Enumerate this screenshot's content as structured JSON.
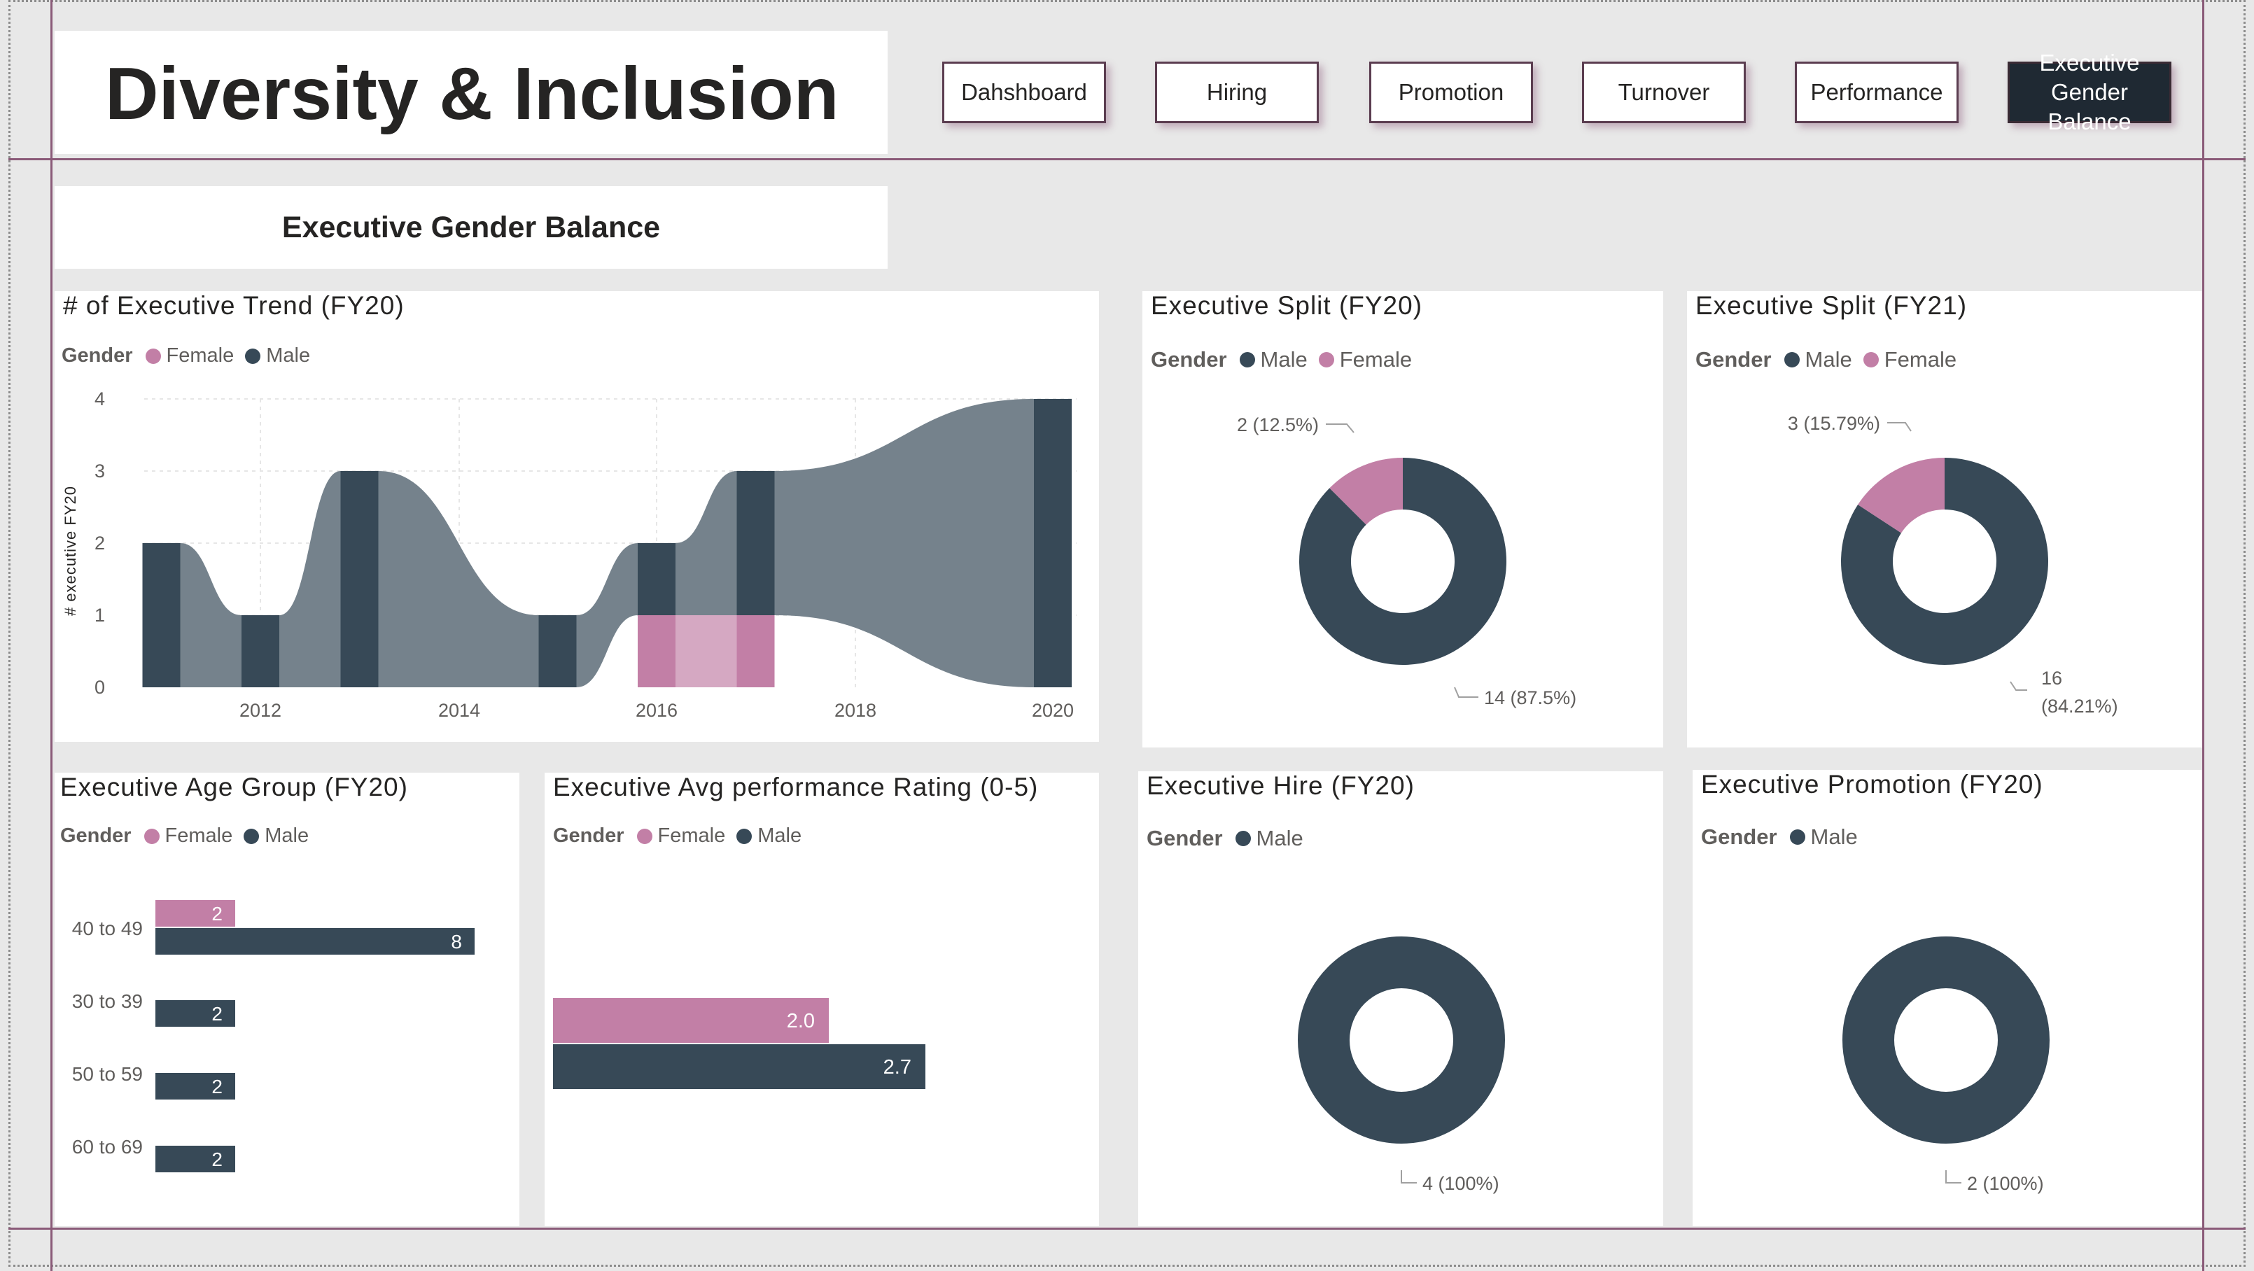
{
  "header": {
    "title": "Diversity & Inclusion",
    "subtitle": "Executive Gender Balance"
  },
  "nav": [
    {
      "label": "Dahshboard",
      "active": false
    },
    {
      "label": "Hiring",
      "active": false
    },
    {
      "label": "Promotion",
      "active": false
    },
    {
      "label": "Turnover",
      "active": false
    },
    {
      "label": "Performance",
      "active": false
    },
    {
      "label": "Executive Gender Balance",
      "active": true
    }
  ],
  "legend_title": "Gender",
  "colors": {
    "female": "#c27fa6",
    "male": "#374957",
    "ribbon": "#75828c",
    "female_ribbon": "#d5a8c2"
  },
  "chart_data": [
    {
      "type": "area",
      "subtype": "ribbon",
      "title": "# of Executive Trend (FY20)",
      "ylabel": "# executive FY20",
      "legend": [
        "Female",
        "Male"
      ],
      "ylim": [
        0,
        4
      ],
      "yticks": [
        "0",
        "1",
        "2",
        "3",
        "4"
      ],
      "xticks": [
        "2012",
        "2014",
        "2016",
        "2018",
        "2020"
      ],
      "x": [
        2011,
        2012,
        2013,
        2015,
        2016,
        2017,
        2020
      ],
      "series": [
        {
          "name": "Female",
          "values": [
            0,
            0,
            0,
            0,
            1,
            1,
            0
          ]
        },
        {
          "name": "Male",
          "values": [
            2,
            1,
            3,
            1,
            1,
            2,
            4
          ]
        }
      ]
    },
    {
      "type": "pie",
      "subtype": "donut",
      "title": "Executive Split (FY20)",
      "legend": [
        "Male",
        "Female"
      ],
      "slices": [
        {
          "name": "Male",
          "value": 14,
          "label": "14 (87.5%)"
        },
        {
          "name": "Female",
          "value": 2,
          "label": "2 (12.5%)"
        }
      ]
    },
    {
      "type": "pie",
      "subtype": "donut",
      "title": "Executive Split (FY21)",
      "legend": [
        "Male",
        "Female"
      ],
      "slices": [
        {
          "name": "Male",
          "value": 16,
          "label_line1": "16",
          "label_line2": "(84.21%)"
        },
        {
          "name": "Female",
          "value": 3,
          "label": "3 (15.79%)"
        }
      ]
    },
    {
      "type": "bar",
      "orientation": "horizontal",
      "title": "Executive Age Group (FY20)",
      "legend": [
        "Female",
        "Male"
      ],
      "categories": [
        "40 to 49",
        "30 to 39",
        "50 to 59",
        "60 to 69"
      ],
      "series": [
        {
          "name": "Female",
          "values": [
            2,
            null,
            null,
            null
          ]
        },
        {
          "name": "Male",
          "values": [
            8,
            2,
            2,
            2
          ]
        }
      ],
      "xlim": [
        0,
        8
      ]
    },
    {
      "type": "bar",
      "orientation": "horizontal",
      "title": "Executive Avg performance Rating (0-5)",
      "legend": [
        "Female",
        "Male"
      ],
      "series": [
        {
          "name": "Female",
          "values": [
            2.0
          ],
          "label": "2.0"
        },
        {
          "name": "Male",
          "values": [
            2.7
          ],
          "label": "2.7"
        }
      ],
      "xlim": [
        0,
        4.1
      ]
    },
    {
      "type": "pie",
      "subtype": "donut",
      "title": "Executive Hire (FY20)",
      "legend": [
        "Male"
      ],
      "slices": [
        {
          "name": "Male",
          "value": 4,
          "label": "4 (100%)"
        }
      ]
    },
    {
      "type": "pie",
      "subtype": "donut",
      "title": "Executive Promotion (FY20)",
      "legend": [
        "Male"
      ],
      "slices": [
        {
          "name": "Male",
          "value": 2,
          "label": "2 (100%)"
        }
      ]
    }
  ]
}
